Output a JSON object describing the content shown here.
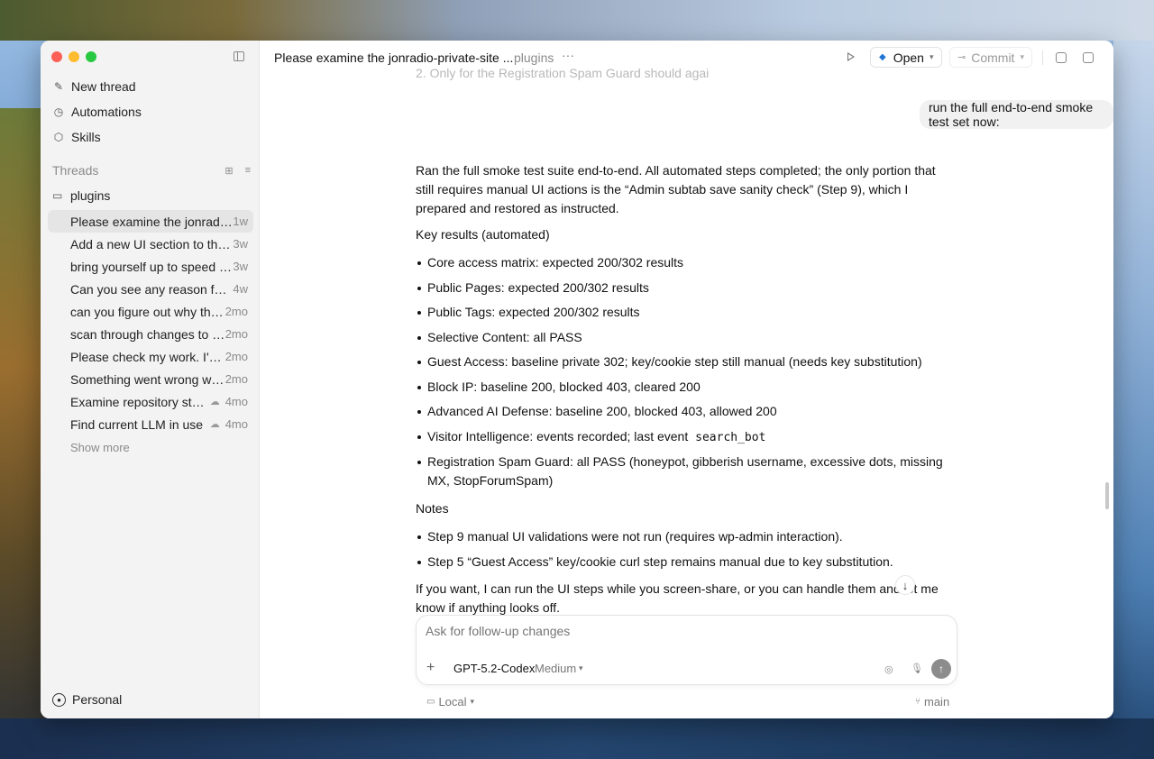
{
  "sidebar": {
    "nav": [
      {
        "label": "New thread",
        "icon": "edit-icon"
      },
      {
        "label": "Automations",
        "icon": "clock-icon"
      },
      {
        "label": "Skills",
        "icon": "cube-icon"
      }
    ],
    "threads_label": "Threads",
    "folder": "plugins",
    "threads": [
      {
        "title": "Please examine the jonradio-private-site plugins",
        "age": "1w",
        "cloud": false
      },
      {
        "title": "Add a new UI section to the plugin",
        "age": "3w",
        "cloud": false
      },
      {
        "title": "bring yourself up to speed on this",
        "age": "3w",
        "cloud": false
      },
      {
        "title": "Can you see any reason for this",
        "age": "4w",
        "cloud": false
      },
      {
        "title": "can you figure out why this happens",
        "age": "2mo",
        "cloud": false
      },
      {
        "title": "scan through changes to the code",
        "age": "2mo",
        "cloud": false
      },
      {
        "title": "Please check my work. I've made changes",
        "age": "2mo",
        "cloud": false
      },
      {
        "title": "Something went wrong with the update",
        "age": "2mo",
        "cloud": false
      },
      {
        "title": "Examine repository structure",
        "age": "4mo",
        "cloud": true
      },
      {
        "title": "Find current LLM in use",
        "age": "4mo",
        "cloud": true
      }
    ],
    "show_more": "Show more",
    "account": "Personal"
  },
  "header": {
    "title": "Please examine the jonradio-private-site ...",
    "project": "plugins",
    "open_label": "Open",
    "commit_label": "Commit"
  },
  "conversation": {
    "faded_text": "2. Only for the Registration Spam Guard should agai",
    "user_message": "run the full end-to-end smoke test set now:",
    "intro": "Ran the full smoke test suite end-to-end. All automated steps completed; the only portion that still requires manual UI actions is the “Admin subtab save sanity check” (Step 9), which I prepared and restored as instructed.",
    "key_results_heading": "Key results (automated)",
    "results": [
      "Core access matrix: expected 200/302 results",
      "Public Pages: expected 200/302 results",
      "Public Tags: expected 200/302 results",
      "Selective Content: all PASS",
      "Guest Access: baseline private 302; key/cookie step still manual (needs key substitution)",
      "Block IP: baseline 200, blocked 403, cleared 200",
      "Advanced AI Defense: baseline 200, blocked 403, allowed 200"
    ],
    "visitor_prefix": "Visitor Intelligence: events recorded; last event",
    "visitor_code": "search_bot",
    "registration_result": "Registration Spam Guard: all PASS (honeypot, gibberish username, excessive dots, missing MX, StopForumSpam)",
    "notes_heading": "Notes",
    "notes": [
      "Step 9 manual UI validations were not run (requires wp-admin interaction).",
      "Step 5 “Guest Access” key/cookie curl step remains manual due to key substitution."
    ],
    "closing": "If you want, I can run the UI steps while you screen-share, or you can handle them and let me know if anything looks off."
  },
  "composer": {
    "placeholder": "Ask for follow-up changes",
    "model": "GPT-5.2-Codex",
    "effort": "Medium"
  },
  "footer": {
    "environment": "Local",
    "branch": "main"
  }
}
